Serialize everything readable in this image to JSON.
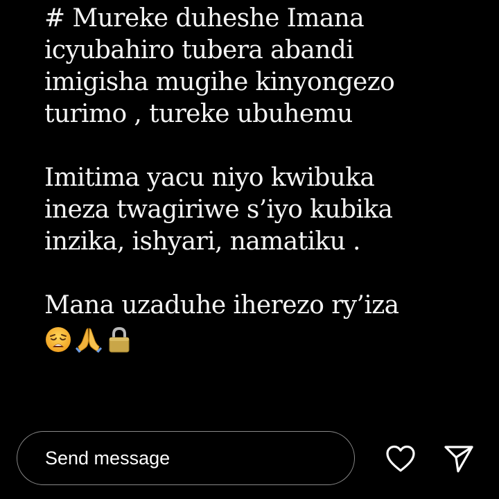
{
  "story": {
    "paragraphs": [
      {
        "lines": [
          "# Mureke duheshe Imana",
          "icyubahiro tubera abandi",
          "imigisha mugihe kinyongezo",
          "turimo , tureke ubuhemu"
        ]
      },
      {
        "lines": [
          "Imitima yacu niyo kwibuka",
          "ineza twagiriwe s’iyo kubika",
          "inzika, ishyari, namatiku ."
        ]
      },
      {
        "lines": [
          "Mana uzaduhe iherezo ry’iza"
        ]
      }
    ],
    "emojis": [
      "weary-face-icon",
      "folded-hands-icon",
      "padlock-icon"
    ]
  },
  "reply": {
    "placeholder": "Send message"
  },
  "actions": {
    "like_icon": "heart-icon",
    "share_icon": "paper-plane-icon"
  },
  "colors": {
    "background": "#000000",
    "text": "#f4f4f4",
    "bar_border": "#8a8a8a"
  }
}
